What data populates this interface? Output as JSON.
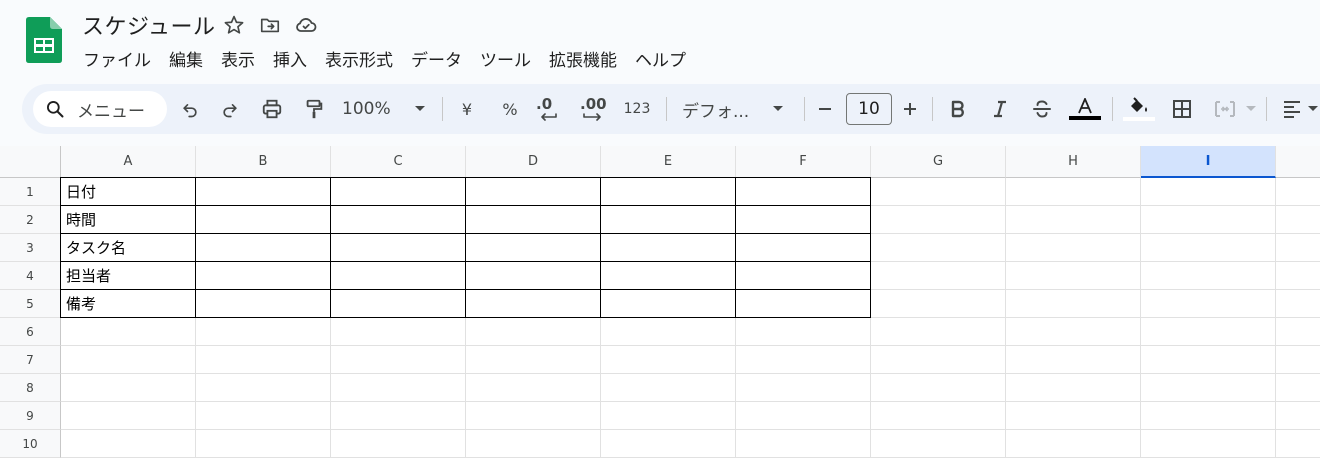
{
  "header": {
    "title": "スケジュール",
    "menu": [
      "ファイル",
      "編集",
      "表示",
      "挿入",
      "表示形式",
      "データ",
      "ツール",
      "拡張機能",
      "ヘルプ"
    ]
  },
  "toolbar": {
    "search_label": "メニュー",
    "zoom": "100%",
    "currency": "¥",
    "percent": "%",
    "decimal_decrease": ".0",
    "decimal_increase": ".00",
    "number_format": "123",
    "font": "デフォ...",
    "font_size": "10"
  },
  "sheet": {
    "columns": [
      "A",
      "B",
      "C",
      "D",
      "E",
      "F",
      "G",
      "H",
      "I"
    ],
    "selected_column": "I",
    "rows": [
      "1",
      "2",
      "3",
      "4",
      "5",
      "6",
      "7",
      "8",
      "9",
      "10"
    ],
    "column_a_values": [
      "日付",
      "時間",
      "タスク名",
      "担当者",
      "備考"
    ]
  },
  "colors": {
    "sheets_green": "#0f9d58",
    "toolbar_bg": "#edf2fa",
    "selected_header": "#d3e3fd"
  }
}
